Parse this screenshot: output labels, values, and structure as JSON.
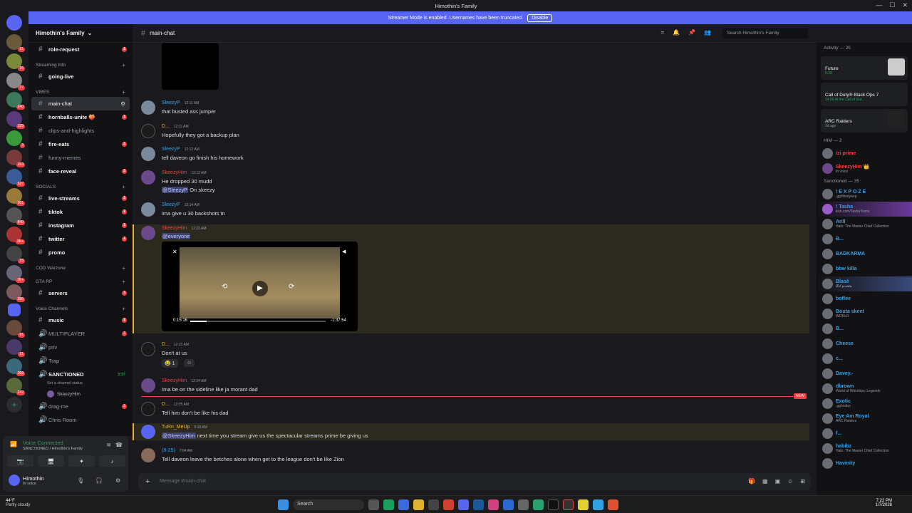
{
  "window": {
    "title": "Himothin's Family"
  },
  "banner": {
    "text": "Streamer Mode is enabled. Usernames have been truncated.",
    "button": "Disable"
  },
  "guild": {
    "name": "Himothin's Family"
  },
  "channels": {
    "top": [
      {
        "name": "role-request",
        "badge": "2"
      }
    ],
    "cat1": "Streaming Info",
    "c1": [
      {
        "name": "going-live"
      }
    ],
    "cat2": "VIBES",
    "c2": [
      {
        "name": "main-chat"
      },
      {
        "name": "hornballs-unite 🍑",
        "badge": "2"
      },
      {
        "name": "clips-and-highlights"
      },
      {
        "name": "fire-eats",
        "badge": "2"
      },
      {
        "name": "funny-memes"
      },
      {
        "name": "face-reveal",
        "badge": "2"
      }
    ],
    "cat3": "SOCIALS",
    "c3": [
      {
        "name": "live-streams",
        "badge": "2"
      },
      {
        "name": "tiktok",
        "badge": "2"
      },
      {
        "name": "instagram",
        "badge": "2"
      },
      {
        "name": "twitter",
        "badge": "2"
      },
      {
        "name": "promo"
      }
    ],
    "cat4": "COD Warzone",
    "cat5": "GTA RP",
    "c5": [
      {
        "name": "servers",
        "badge": "3"
      }
    ],
    "cat6": "Voice Channels",
    "c6": [
      {
        "name": "music",
        "badge": "2"
      },
      {
        "name": "MULTIPLAYER",
        "badge": "2"
      },
      {
        "name": "priv"
      },
      {
        "name": "Trap"
      },
      {
        "name": "SANCTIONED",
        "time": "3:37"
      }
    ],
    "sanctioned_status": "Set a channel status",
    "sanctioned_user": "SkeezyHim",
    "c7": [
      {
        "name": "drag-me",
        "badge": "2"
      },
      {
        "name": "Chris Room"
      }
    ]
  },
  "voice": {
    "status": "Voice Connected",
    "sub": "SANCTIONED / Himothin's Family"
  },
  "me": {
    "name": "Himothin",
    "status": "In voice"
  },
  "header": {
    "channel": "main-chat",
    "search": "Search Himothin's Family"
  },
  "messages": [
    {
      "name": "SleezyP",
      "color": "#3d9fe3",
      "time": "12:11 AM",
      "text": "that busted ass jumper"
    },
    {
      "name": "D...",
      "color": "#f0b232",
      "time": "12:11 AM",
      "text": "Hopefully they got a backup plan"
    },
    {
      "name": "SleezyP",
      "color": "#3d9fe3",
      "time": "12:12 AM",
      "text": "tell daveon go finish his homework"
    },
    {
      "name": "SkeezyHim",
      "color": "#f23f43",
      "time": "12:12 AM",
      "text": "He dropped 30 mudd",
      "mention": "@SleezyP",
      "text2": " On skeezy"
    },
    {
      "name": "SleezyP",
      "color": "#3d9fe3",
      "time": "12:14 AM",
      "text": "ima give u 30 backshots tn"
    },
    {
      "name": "SkeezyHim",
      "color": "#f23f43",
      "time": "12:22 AM",
      "mention": "@everyone"
    },
    {
      "name": "D...",
      "color": "#f0b232",
      "time": "12:22 AM",
      "text": "Don't at us",
      "reaction": "😂 1"
    },
    {
      "name": "SkeezyHim",
      "color": "#f23f43",
      "time": "12:24 AM",
      "text": "Ima be on the sideline like ja morant dad"
    },
    {
      "name": "D...",
      "color": "#f0b232",
      "time": "12:25 AM",
      "text": "Tell him don't be like his dad"
    },
    {
      "name": "TuRn_MeUp",
      "color": "#f0b232",
      "time": "5:18 AM",
      "mention": "@SkeezyHim",
      "text2": " next time you stream give us the spectacular streams prime be giving us"
    },
    {
      "name": "(8-25)",
      "color": "#3d9fe3",
      "time": "7:04 AM",
      "text": "Tell daveon leave the betches alone when get to the league don't be like Zion"
    }
  ],
  "video": {
    "current": "0:15:16",
    "remaining": "-1:37:54"
  },
  "newtag": "NEW",
  "input": {
    "placeholder": "Message #main-chat"
  },
  "members": {
    "activity_label": "Activity — 25",
    "activities": [
      {
        "title": "Future",
        "sub": "5:39"
      },
      {
        "title": "Call of Duty® Black Ops 7",
        "sub": "14:06  At the Call of Dut..."
      },
      {
        "title": "ARC Raiders",
        "sub": "2d ago"
      }
    ],
    "him_label": "HIM — 2",
    "him": [
      {
        "name": "izi prime",
        "color": "#f23f43",
        "sub": ""
      },
      {
        "name": "SkeezyHim 👑",
        "color": "#f23f43",
        "sub": "In voice"
      }
    ],
    "sanc_label": "Sanctioned — 35",
    "sanc": [
      {
        "name": "! E X P O Z E",
        "sub": ".gg/lifestylerp",
        "color": "#3d9fe3"
      },
      {
        "name": "! Tasha",
        "sub": "kick.com/TashaToons",
        "color": "#3d9fe3"
      },
      {
        "name": "Arill",
        "sub": "Halo: The Master Chief Collection",
        "color": "#3d9fe3"
      },
      {
        "name": "B...",
        "sub": "",
        "color": "#3d9fe3"
      },
      {
        "name": "BADKARMA",
        "sub": "",
        "color": "#3d9fe3"
      },
      {
        "name": "bbw killa",
        "sub": "",
        "color": "#3d9fe3"
      },
      {
        "name": "Blasé",
        "sub": "𝓛𝓲𝓵 𝓰𝓸𝓭𝓭𝓪",
        "color": "#3d9fe3"
      },
      {
        "name": "boffee",
        "sub": "",
        "color": "#3d9fe3"
      },
      {
        "name": "Bouta skeet",
        "sub": "WORLD",
        "color": "#3d9fe3"
      },
      {
        "name": "B...",
        "sub": "",
        "color": "#3d9fe3"
      },
      {
        "name": "Cheese",
        "sub": "",
        "color": "#3d9fe3"
      },
      {
        "name": "c...",
        "sub": "",
        "color": "#3d9fe3"
      },
      {
        "name": "Davey.-",
        "sub": "",
        "color": "#3d9fe3"
      },
      {
        "name": "dbrown",
        "sub": "World of Warships: Legends",
        "color": "#3d9fe3"
      },
      {
        "name": "Exotic",
        "sub": ".gg/sobrp",
        "color": "#3d9fe3"
      },
      {
        "name": "Eye Am Royal",
        "sub": "ARC Raiders",
        "color": "#3d9fe3"
      },
      {
        "name": "f...",
        "sub": "",
        "color": "#3d9fe3"
      },
      {
        "name": "habibz",
        "sub": "Halo: The Master Chief Collection",
        "color": "#3d9fe3"
      },
      {
        "name": "Havinity",
        "sub": "",
        "color": "#3d9fe3"
      }
    ]
  },
  "taskbar": {
    "weather": "44°F",
    "weather_sub": "Partly cloudy",
    "search": "Search",
    "time": "7:22 PM",
    "date": "1/7/2026"
  }
}
